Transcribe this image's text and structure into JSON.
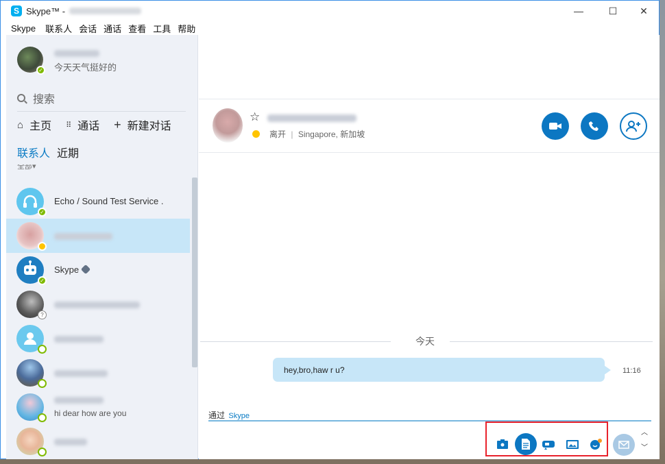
{
  "window": {
    "app_title": "Skype™ -",
    "controls": {
      "minimize": "—",
      "maximize": "☐",
      "close": "✕"
    }
  },
  "menu": [
    "Skype",
    "联系人",
    "会话",
    "通话",
    "查看",
    "工具",
    "帮助"
  ],
  "profile": {
    "mood": "今天天气挺好的",
    "status": "online"
  },
  "search": {
    "placeholder": "搜索"
  },
  "nav": {
    "home": "主页",
    "calls": "通话",
    "new_chat": "新建对话"
  },
  "tabs": {
    "contacts": "联系人",
    "recent": "近期"
  },
  "filter_label": "全部▾",
  "contacts": [
    {
      "name": "Echo / Sound Test Service .",
      "status": "online",
      "avatar": "echo-headset",
      "color": "#5fc6ee"
    },
    {
      "name": "",
      "status": "away",
      "avatar": "photo",
      "selected": true,
      "color": "#e4b3b3"
    },
    {
      "name": "Skype",
      "status": "online",
      "avatar": "skype-bot",
      "verified": true,
      "color": "#1f7ec1"
    },
    {
      "name": "",
      "status": "unknown",
      "avatar": "photo",
      "color": "#6b6b6b"
    },
    {
      "name": "",
      "status": "offline",
      "avatar": "default-person",
      "color": "#6bc9ee"
    },
    {
      "name": "",
      "status": "offline",
      "avatar": "photo",
      "color": "#4b6b9a"
    },
    {
      "name": "",
      "subtitle": "hi dear how are you",
      "status": "offline",
      "avatar": "photo",
      "color": "#62b6e3"
    },
    {
      "name": "",
      "status": "offline",
      "avatar": "photo",
      "color": "#f2d2b8"
    }
  ],
  "conversation": {
    "status": "离开",
    "location": "Singapore, 新加坡",
    "day_label": "今天",
    "message": {
      "text": "hey,bro,haw r u?",
      "time": "11:16"
    },
    "via_label": "通过",
    "via_service": "Skype"
  },
  "icons": {
    "video_call": "video-camera-icon",
    "audio_call": "phone-icon",
    "add_people": "add-person-icon",
    "send": "send-icon"
  },
  "colors": {
    "accent": "#0c77c2",
    "selected": "#c7e6f8",
    "online": "#7fba00",
    "away": "#ffc400",
    "highlight_box": "#e8212b"
  }
}
